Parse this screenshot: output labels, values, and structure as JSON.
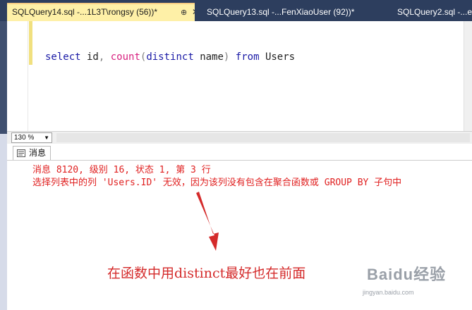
{
  "tabs": [
    {
      "label": "SQLQuery14.sql -...1L3T\\rongsy (56))*",
      "active": true
    },
    {
      "label": "SQLQuery13.sql -...FenXiaoUser (92))*",
      "active": false
    },
    {
      "label": "SQLQuery2.sql -...e",
      "active": false
    }
  ],
  "tab_pin_icon": "⊕",
  "tab_close_icon": "✕",
  "editor": {
    "code_tokens": [
      {
        "text": "select",
        "cls": "kw-blue"
      },
      {
        "text": " id",
        "cls": "plain"
      },
      {
        "text": ", ",
        "cls": "gray"
      },
      {
        "text": "count",
        "cls": "kw-pink"
      },
      {
        "text": "(",
        "cls": "gray"
      },
      {
        "text": "distinct",
        "cls": "kw-blue"
      },
      {
        "text": " name",
        "cls": "plain"
      },
      {
        "text": ")",
        "cls": "gray"
      },
      {
        "text": " from",
        "cls": "kw-blue"
      },
      {
        "text": " Users",
        "cls": "plain"
      }
    ]
  },
  "zoom": {
    "value": "130 %"
  },
  "results": {
    "tab_label": "消息",
    "error_line_1": "消息 8120, 级别 16, 状态 1, 第 3 行",
    "error_line_2": "选择列表中的列 'Users.ID' 无效，因为该列没有包含在聚合函数或 GROUP BY 子句中"
  },
  "annotation": {
    "text": "在函数中用distinct最好也在前面",
    "color": "#d42a2a"
  },
  "watermark": {
    "logo": "Baidu经验",
    "url": "jingyan.baidu.com"
  },
  "colors": {
    "accent_tab": "#fef0a7",
    "frame": "#2d3e5e",
    "error": "#e02020"
  }
}
